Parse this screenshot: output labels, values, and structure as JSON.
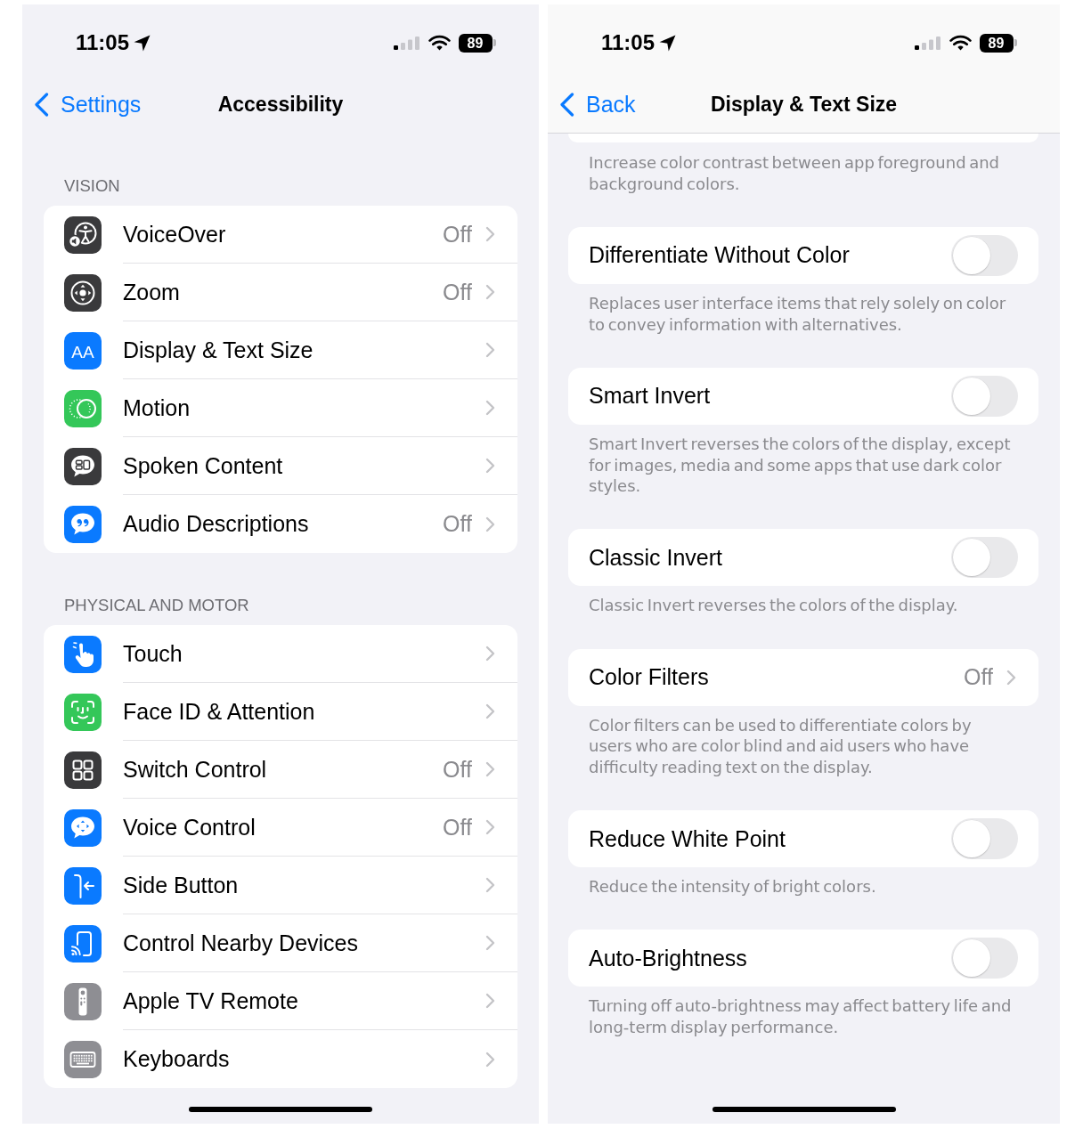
{
  "left_screen": {
    "status_bar": {
      "time": "11:05",
      "battery": "89"
    },
    "nav_bar": {
      "back": "Settings",
      "title": "Accessibility"
    },
    "sections": [
      {
        "header": "VISION",
        "rows": [
          {
            "label": "VoiceOver",
            "value": "Off"
          },
          {
            "label": "Zoom",
            "value": "Off"
          },
          {
            "label": "Display & Text Size",
            "icon_text": "AA"
          },
          {
            "label": "Motion"
          },
          {
            "label": "Spoken Content"
          },
          {
            "label": "Audio Descriptions",
            "value": "Off"
          }
        ]
      },
      {
        "header": "PHYSICAL AND MOTOR",
        "rows": [
          {
            "label": "Touch"
          },
          {
            "label": "Face ID & Attention"
          },
          {
            "label": "Switch Control",
            "value": "Off"
          },
          {
            "label": "Voice Control",
            "value": "Off"
          },
          {
            "label": "Side Button"
          },
          {
            "label": "Control Nearby Devices"
          },
          {
            "label": "Apple TV Remote"
          },
          {
            "label": "Keyboards"
          }
        ]
      }
    ]
  },
  "right_screen": {
    "status_bar": {
      "time": "11:05",
      "battery": "89"
    },
    "nav_bar": {
      "back": "Back",
      "title": "Display & Text Size"
    },
    "top_footer": "Increase color contrast between app foreground and background colors.",
    "groups": [
      {
        "kind": "toggle",
        "label": "Differentiate Without Color",
        "on": false,
        "footer": "Replaces user interface items that rely solely on color to convey information with alternatives."
      },
      {
        "kind": "toggle",
        "label": "Smart Invert",
        "on": false,
        "footer": "Smart Invert reverses the colors of the display, except for images, media and some apps that use dark color styles."
      },
      {
        "kind": "toggle",
        "label": "Classic Invert",
        "on": false,
        "footer": "Classic Invert reverses the colors of the display."
      },
      {
        "kind": "link",
        "label": "Color Filters",
        "value": "Off",
        "footer": "Color filters can be used to differentiate colors by users who are color blind and aid users who have difficulty reading text on the display."
      },
      {
        "kind": "toggle",
        "label": "Reduce White Point",
        "on": false,
        "footer": "Reduce the intensity of bright colors."
      },
      {
        "kind": "toggle",
        "label": "Auto-Brightness",
        "on": false,
        "footer": "Turning off auto-brightness may affect battery life and long-term display performance."
      }
    ]
  }
}
